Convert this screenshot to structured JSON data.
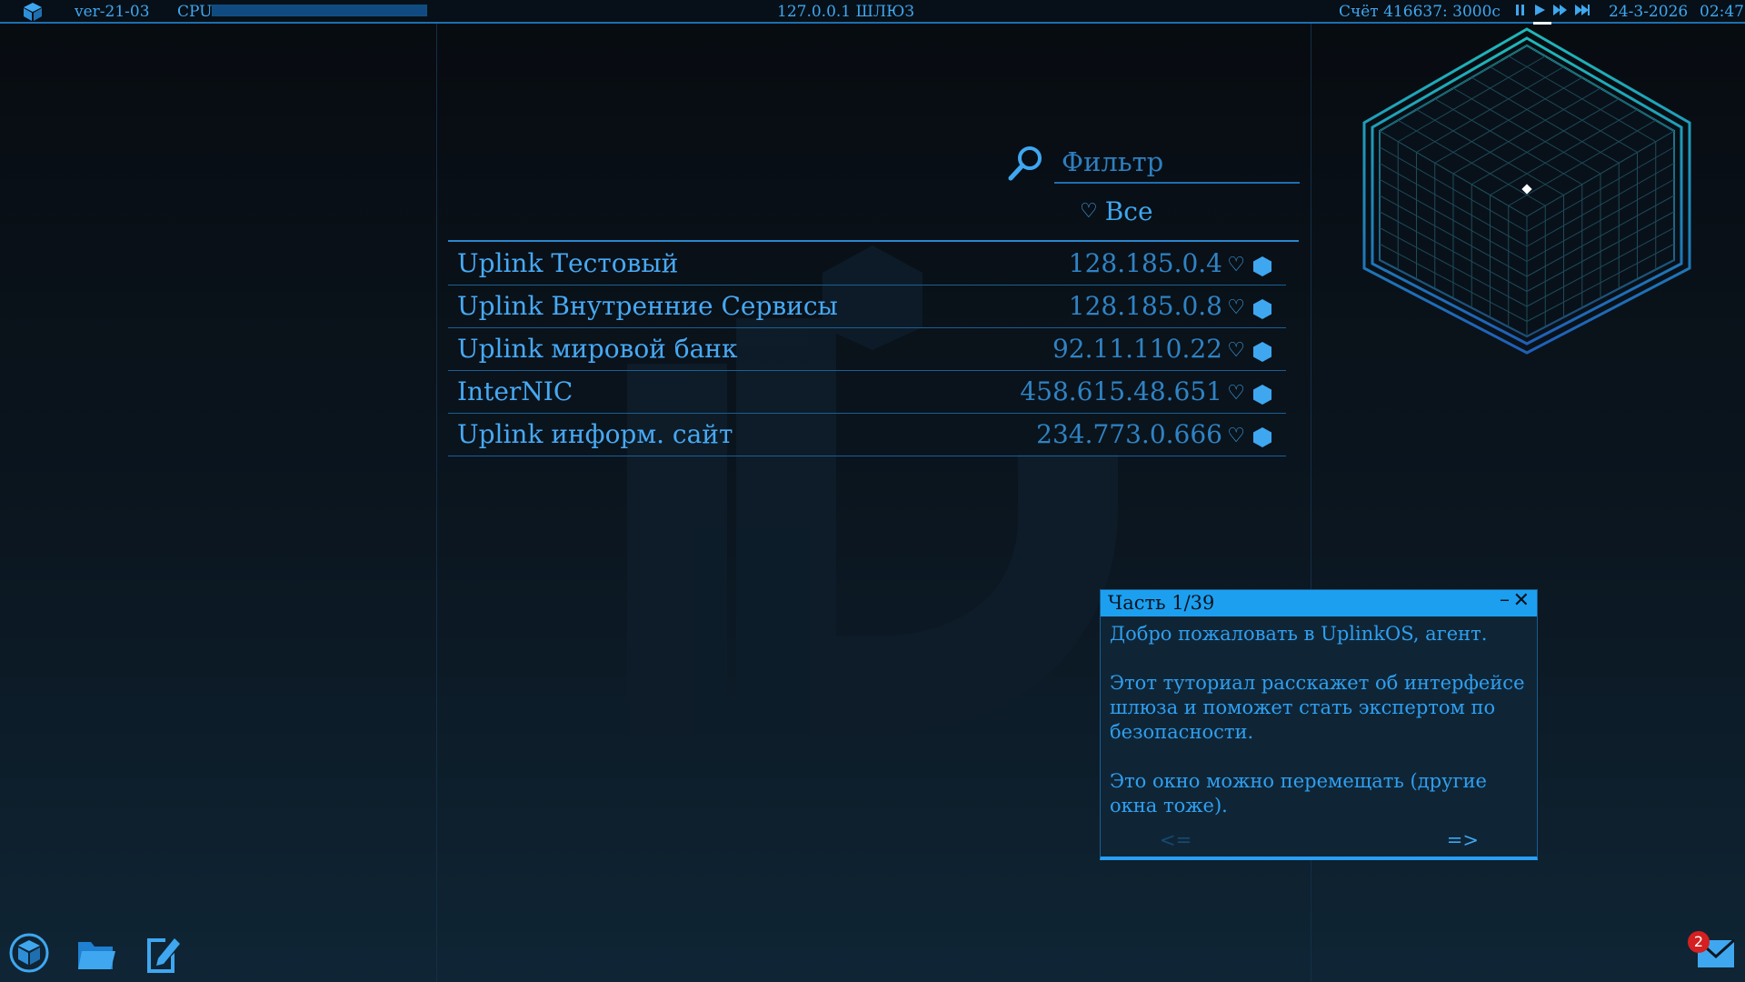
{
  "topbar": {
    "version": "ver-21-03",
    "cpu_label": "CPU",
    "cpu_usage": 1.0,
    "gateway": "127.0.0.1  ШЛЮЗ",
    "balance": "Счёт 416637: 3000c",
    "date": "24-3-2026",
    "time": "02:47"
  },
  "filter": {
    "placeholder": "Фильтр",
    "favorites_label": "Все"
  },
  "servers": [
    {
      "name": "Uplink Тестовый",
      "ip": "128.185.0.4"
    },
    {
      "name": "Uplink Внутренние Сервисы",
      "ip": "128.185.0.8"
    },
    {
      "name": "Uplink мировой банк",
      "ip": "92.11.110.22"
    },
    {
      "name": "InterNIC",
      "ip": "458.615.48.651"
    },
    {
      "name": "Uplink информ. сайт",
      "ip": "234.773.0.666"
    }
  ],
  "tutorial": {
    "title": "Часть 1/39",
    "para1": "Добро пожаловать в UplinkOS, агент.",
    "para2": "Этот туториал расскажет об интерфейсе шлюза и поможет стать экспертом по безопасности.",
    "para3": "Это окно можно перемещать (другие окна тоже).",
    "prev": "<=",
    "next": "=>"
  },
  "mail": {
    "unread_count": "2"
  },
  "colors": {
    "accent": "#1d9ff0",
    "text": "#3fa7f0",
    "badge": "#d42020"
  }
}
